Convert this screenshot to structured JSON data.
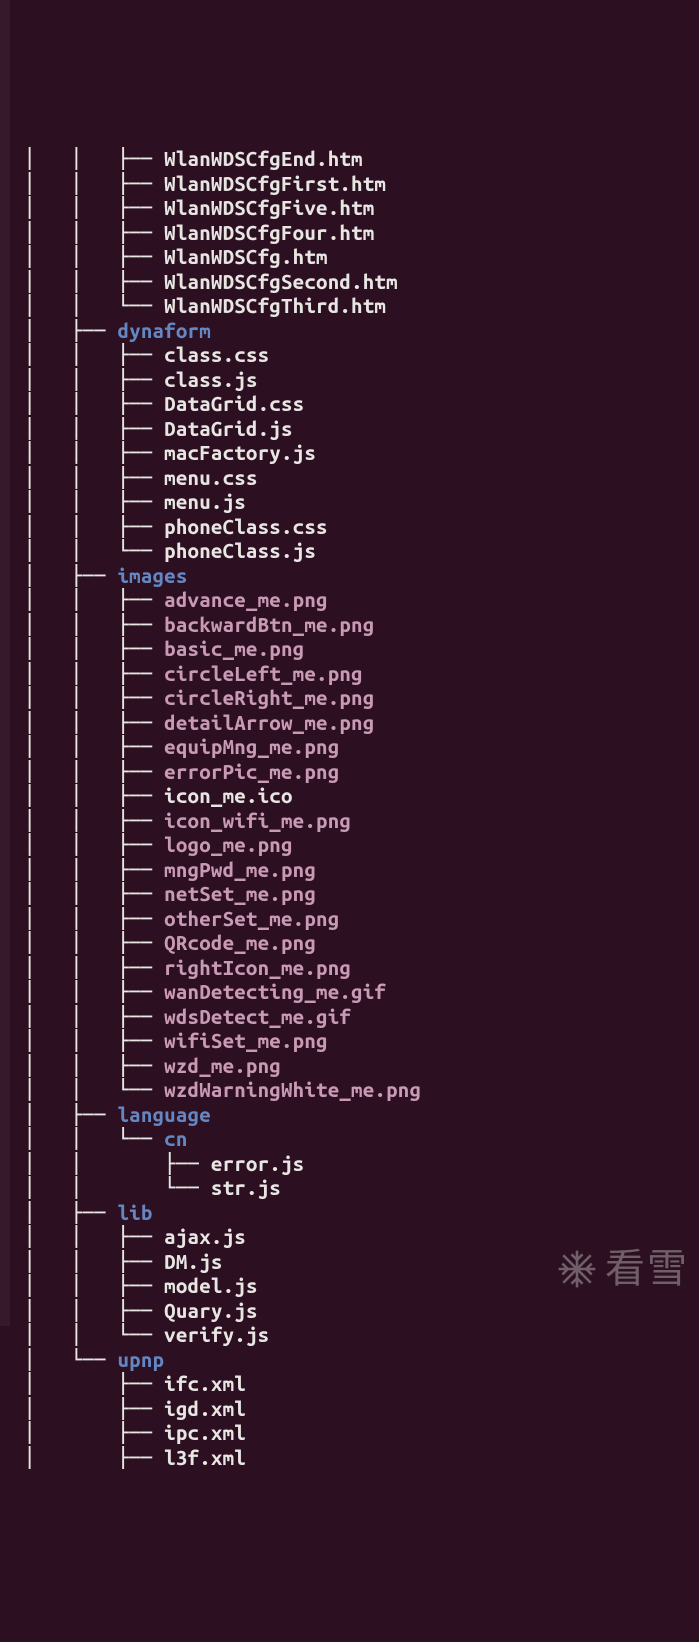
{
  "watermark_text": "看雪",
  "tree": [
    {
      "indent": [
        "│   ",
        "│   ",
        "├── "
      ],
      "type": "file",
      "name": "WlanWDSCfgEnd",
      "ext": ".htm"
    },
    {
      "indent": [
        "│   ",
        "│   ",
        "├── "
      ],
      "type": "file",
      "name": "WlanWDSCfgFirst",
      "ext": ".htm"
    },
    {
      "indent": [
        "│   ",
        "│   ",
        "├── "
      ],
      "type": "file",
      "name": "WlanWDSCfgFive",
      "ext": ".htm"
    },
    {
      "indent": [
        "│   ",
        "│   ",
        "├── "
      ],
      "type": "file",
      "name": "WlanWDSCfgFour",
      "ext": ".htm"
    },
    {
      "indent": [
        "│   ",
        "│   ",
        "├── "
      ],
      "type": "file",
      "name": "WlanWDSCfg",
      "ext": ".htm"
    },
    {
      "indent": [
        "│   ",
        "│   ",
        "├── "
      ],
      "type": "file",
      "name": "WlanWDSCfgSecond",
      "ext": ".htm"
    },
    {
      "indent": [
        "│   ",
        "│   ",
        "└── "
      ],
      "type": "file",
      "name": "WlanWDSCfgThird",
      "ext": ".htm"
    },
    {
      "indent": [
        "│   ",
        "├── "
      ],
      "type": "dir",
      "name": "dynaform"
    },
    {
      "indent": [
        "│   ",
        "│   ",
        "├── "
      ],
      "type": "file",
      "name": "class",
      "ext": ".css"
    },
    {
      "indent": [
        "│   ",
        "│   ",
        "├── "
      ],
      "type": "file",
      "name": "class",
      "ext": ".js"
    },
    {
      "indent": [
        "│   ",
        "│   ",
        "├── "
      ],
      "type": "file",
      "name": "DataGrid",
      "ext": ".css"
    },
    {
      "indent": [
        "│   ",
        "│   ",
        "├── "
      ],
      "type": "file",
      "name": "DataGrid",
      "ext": ".js"
    },
    {
      "indent": [
        "│   ",
        "│   ",
        "├── "
      ],
      "type": "file",
      "name": "macFactory",
      "ext": ".js"
    },
    {
      "indent": [
        "│   ",
        "│   ",
        "├── "
      ],
      "type": "file",
      "name": "menu",
      "ext": ".css"
    },
    {
      "indent": [
        "│   ",
        "│   ",
        "├── "
      ],
      "type": "file",
      "name": "menu",
      "ext": ".js"
    },
    {
      "indent": [
        "│   ",
        "│   ",
        "├── "
      ],
      "type": "file",
      "name": "phoneClass",
      "ext": ".css"
    },
    {
      "indent": [
        "│   ",
        "│   ",
        "└── "
      ],
      "type": "file",
      "name": "phoneClass",
      "ext": ".js"
    },
    {
      "indent": [
        "│   ",
        "├── "
      ],
      "type": "dir",
      "name": "images"
    },
    {
      "indent": [
        "│   ",
        "│   ",
        "├── "
      ],
      "type": "ext",
      "name": "advance_me.png"
    },
    {
      "indent": [
        "│   ",
        "│   ",
        "├── "
      ],
      "type": "ext",
      "name": "backwardBtn_me.png"
    },
    {
      "indent": [
        "│   ",
        "│   ",
        "├── "
      ],
      "type": "ext",
      "name": "basic_me.png"
    },
    {
      "indent": [
        "│   ",
        "│   ",
        "├── "
      ],
      "type": "ext",
      "name": "circleLeft_me.png"
    },
    {
      "indent": [
        "│   ",
        "│   ",
        "├── "
      ],
      "type": "ext",
      "name": "circleRight_me.png"
    },
    {
      "indent": [
        "│   ",
        "│   ",
        "├── "
      ],
      "type": "ext",
      "name": "detailArrow_me.png"
    },
    {
      "indent": [
        "│   ",
        "│   ",
        "├── "
      ],
      "type": "ext",
      "name": "equipMng_me.png"
    },
    {
      "indent": [
        "│   ",
        "│   ",
        "├── "
      ],
      "type": "ext",
      "name": "errorPic_me.png"
    },
    {
      "indent": [
        "│   ",
        "│   ",
        "├── "
      ],
      "type": "file",
      "name": "icon_me",
      "ext": ".ico"
    },
    {
      "indent": [
        "│   ",
        "│   ",
        "├── "
      ],
      "type": "ext",
      "name": "icon_wifi_me.png"
    },
    {
      "indent": [
        "│   ",
        "│   ",
        "├── "
      ],
      "type": "ext",
      "name": "logo_me.png"
    },
    {
      "indent": [
        "│   ",
        "│   ",
        "├── "
      ],
      "type": "ext",
      "name": "mngPwd_me.png"
    },
    {
      "indent": [
        "│   ",
        "│   ",
        "├── "
      ],
      "type": "ext",
      "name": "netSet_me.png"
    },
    {
      "indent": [
        "│   ",
        "│   ",
        "├── "
      ],
      "type": "ext",
      "name": "otherSet_me.png"
    },
    {
      "indent": [
        "│   ",
        "│   ",
        "├── "
      ],
      "type": "ext",
      "name": "QRcode_me.png"
    },
    {
      "indent": [
        "│   ",
        "│   ",
        "├── "
      ],
      "type": "ext",
      "name": "rightIcon_me.png"
    },
    {
      "indent": [
        "│   ",
        "│   ",
        "├── "
      ],
      "type": "ext",
      "name": "wanDetecting_me.gif"
    },
    {
      "indent": [
        "│   ",
        "│   ",
        "├── "
      ],
      "type": "ext",
      "name": "wdsDetect_me.gif"
    },
    {
      "indent": [
        "│   ",
        "│   ",
        "├── "
      ],
      "type": "ext",
      "name": "wifiSet_me.png"
    },
    {
      "indent": [
        "│   ",
        "│   ",
        "├── "
      ],
      "type": "ext",
      "name": "wzd_me.png"
    },
    {
      "indent": [
        "│   ",
        "│   ",
        "└── "
      ],
      "type": "ext",
      "name": "wzdWarningWhite_me.png"
    },
    {
      "indent": [
        "│   ",
        "├── "
      ],
      "type": "dir",
      "name": "language"
    },
    {
      "indent": [
        "│   ",
        "│   ",
        "└── "
      ],
      "type": "dir",
      "name": "cn"
    },
    {
      "indent": [
        "│   ",
        "│   ",
        "    ",
        "├── "
      ],
      "type": "file",
      "name": "error",
      "ext": ".js"
    },
    {
      "indent": [
        "│   ",
        "│   ",
        "    ",
        "└── "
      ],
      "type": "file",
      "name": "str",
      "ext": ".js"
    },
    {
      "indent": [
        "│   ",
        "├── "
      ],
      "type": "dir",
      "name": "lib"
    },
    {
      "indent": [
        "│   ",
        "│   ",
        "├── "
      ],
      "type": "file",
      "name": "ajax",
      "ext": ".js"
    },
    {
      "indent": [
        "│   ",
        "│   ",
        "├── "
      ],
      "type": "file",
      "name": "DM",
      "ext": ".js"
    },
    {
      "indent": [
        "│   ",
        "│   ",
        "├── "
      ],
      "type": "file",
      "name": "model",
      "ext": ".js"
    },
    {
      "indent": [
        "│   ",
        "│   ",
        "├── "
      ],
      "type": "file",
      "name": "Quary",
      "ext": ".js"
    },
    {
      "indent": [
        "│   ",
        "│   ",
        "└── "
      ],
      "type": "file",
      "name": "verify",
      "ext": ".js"
    },
    {
      "indent": [
        "│   ",
        "└── "
      ],
      "type": "dir",
      "name": "upnp"
    },
    {
      "indent": [
        "│   ",
        "    ",
        "├── "
      ],
      "type": "file",
      "name": "ifc",
      "ext": ".xml"
    },
    {
      "indent": [
        "│   ",
        "    ",
        "├── "
      ],
      "type": "file",
      "name": "igd",
      "ext": ".xml"
    },
    {
      "indent": [
        "│   ",
        "    ",
        "├── "
      ],
      "type": "file",
      "name": "ipc",
      "ext": ".xml"
    },
    {
      "indent": [
        "│   ",
        "    ",
        "├── "
      ],
      "type": "file",
      "name": "l3f",
      "ext": ".xml"
    }
  ]
}
